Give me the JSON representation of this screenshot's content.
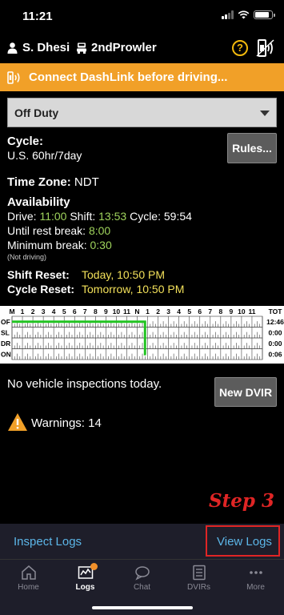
{
  "status_bar": {
    "time": "11:21",
    "battery_fill": 0.9
  },
  "header": {
    "driver_name": "S. Dhesi",
    "vehicle_name": "2ndProwler",
    "help_glyph": "?"
  },
  "banner": {
    "text": "Connect DashLink before driving...",
    "color": "#f1a028"
  },
  "duty_status": {
    "selected": "Off Duty"
  },
  "cycle": {
    "label": "Cycle:",
    "value": "U.S. 60hr/7day",
    "rules_button": "Rules..."
  },
  "time_zone": {
    "label": "Time Zone:",
    "value": "NDT"
  },
  "availability": {
    "heading": "Availability",
    "drive_label": "Drive:",
    "drive_value": "11:00",
    "shift_label": "Shift:",
    "shift_value": "13:53",
    "cycle_label": "Cycle:",
    "cycle_value": "59:54",
    "rest_label": "Until rest break:",
    "rest_value": "8:00",
    "min_break_label": "Minimum break:",
    "min_break_value": "0:30",
    "note": "(Not driving)"
  },
  "resets": {
    "shift_label": "Shift Reset:",
    "shift_value": "Today, 10:50 PM",
    "cycle_label": "Cycle Reset:",
    "cycle_value": "Tomorrow, 10:50 PM"
  },
  "log_grid": {
    "hour_labels": [
      "M",
      "1",
      "2",
      "3",
      "4",
      "5",
      "6",
      "7",
      "8",
      "9",
      "10",
      "11",
      "N",
      "1",
      "2",
      "3",
      "4",
      "5",
      "6",
      "7",
      "8",
      "9",
      "10",
      "11"
    ],
    "total_label": "TOT",
    "rows": [
      {
        "label": "OF",
        "total": "12:46"
      },
      {
        "label": "SL",
        "total": "0:00"
      },
      {
        "label": "DR",
        "total": "0:00"
      },
      {
        "label": "ON",
        "total": "0:06"
      }
    ],
    "line_color": "#22c322",
    "status_line": [
      {
        "hour": 0,
        "row": 0
      },
      {
        "hour": 12.75,
        "row": 0
      },
      {
        "hour": 12.75,
        "row": 3
      },
      {
        "hour": 12.85,
        "row": 3
      }
    ]
  },
  "inspections": {
    "text": "No vehicle inspections today.",
    "new_dvir_button": "New DVIR"
  },
  "warnings": {
    "text": "Warnings: 14"
  },
  "annotation": {
    "step_text": "Step 3"
  },
  "bottom_links": {
    "inspect": "Inspect Logs",
    "view": "View Logs"
  },
  "tabs": [
    {
      "label": "Home",
      "icon": "home-icon"
    },
    {
      "label": "Logs",
      "icon": "logs-icon"
    },
    {
      "label": "Chat",
      "icon": "chat-icon"
    },
    {
      "label": "DVIRs",
      "icon": "dvirs-icon"
    },
    {
      "label": "More",
      "icon": "more-icon"
    }
  ]
}
